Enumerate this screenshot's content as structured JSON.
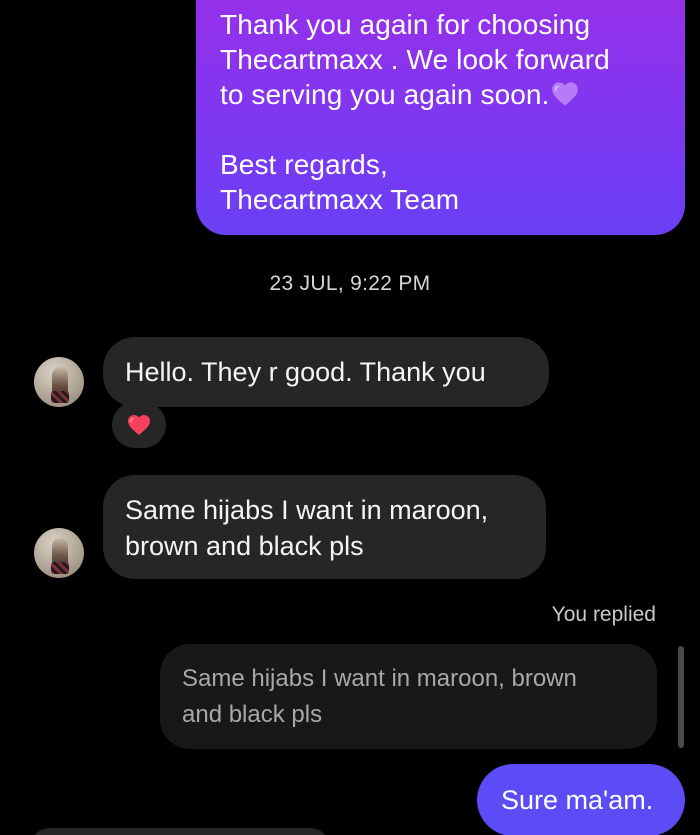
{
  "messages": {
    "outgoing_top": {
      "line1": "Thank you again for choosing",
      "line2": "Thecartmaxx . We look forward",
      "line3": "to serving you again soon.",
      "line4": "Best regards,",
      "line5": "Thecartmaxx Team",
      "emoji": "purple-heart"
    },
    "timestamp": "23 JUL, 9:22 PM",
    "incoming_1": "Hello. They r good. Thank you",
    "incoming_1_reaction": "red-heart",
    "incoming_2_line1": "Same hijabs I want in maroon,",
    "incoming_2_line2": "brown and black pls",
    "replied_label": "You replied",
    "quote_line1": "Same hijabs I want in maroon, brown",
    "quote_line2": "and black pls",
    "outgoing_reply": "Sure ma'am."
  },
  "colors": {
    "gradient_top": "#9b2ee8",
    "gradient_bottom": "#6a40f5",
    "incoming_bubble": "#262626",
    "blue_bubble": "#5b4cf5",
    "background": "#000000"
  }
}
